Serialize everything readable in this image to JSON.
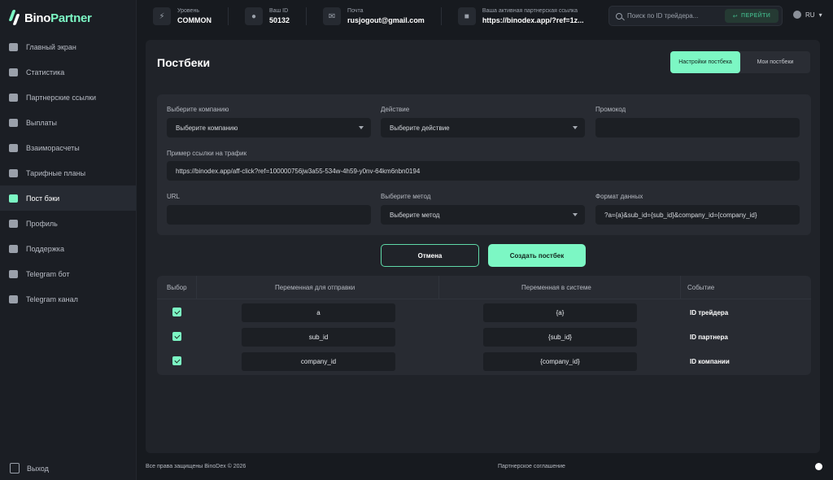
{
  "brand": {
    "name_prefix": "Bino",
    "name_suffix": "Partner"
  },
  "sidebar": {
    "items": [
      {
        "label": "Главный экран",
        "icon": "home-icon"
      },
      {
        "label": "Статистика",
        "icon": "stats-icon"
      },
      {
        "label": "Партнерские ссылки",
        "icon": "link-icon"
      },
      {
        "label": "Выплаты",
        "icon": "payout-icon"
      },
      {
        "label": "Взаиморасчеты",
        "icon": "settlement-icon"
      },
      {
        "label": "Тарифные планы",
        "icon": "tariff-icon"
      },
      {
        "label": "Пост бэки",
        "icon": "postback-icon",
        "active": true
      },
      {
        "label": "Профиль",
        "icon": "profile-icon"
      },
      {
        "label": "Поддержка",
        "icon": "support-icon"
      },
      {
        "label": "Telegram бот",
        "icon": "telegram-icon"
      },
      {
        "label": "Telegram канал",
        "icon": "telegram-icon"
      }
    ],
    "logout": "Выход"
  },
  "topbar": {
    "level_label": "Уровень",
    "level_value": "COMMON",
    "id_label": "Ваш ID",
    "id_value": "50132",
    "email_label": "Почта",
    "email_value": "rusjogout@gmail.com",
    "link_label": "Ваша активная партнерская ссылка",
    "link_value": "https://binodex.app/?ref=1z...",
    "search_placeholder": "Поиск по ID трейдера...",
    "go_label": "ПЕРЕЙТИ",
    "lang": "RU"
  },
  "page": {
    "title": "Постбеки",
    "tabs": [
      "Настройки постбека",
      "Мои постбеки"
    ]
  },
  "form": {
    "company_label": "Выберите компанию",
    "company_value": "Выберите компанию",
    "action_label": "Действие",
    "action_value": "Выберите действие",
    "promo_label": "Промокод",
    "promo_value": "",
    "example_label": "Пример ссылки на трафик",
    "example_value": "https://binodex.app/aff-click?ref=100000756jw3a55-534w-4h59-y0nv-64km6nbn0194",
    "url_label": "URL",
    "url_value": "",
    "method_label": "Выберите метод",
    "method_value": "Выберите метод",
    "format_label": "Формат данных",
    "format_value": "?a={a}&sub_id={sub_id}&company_id={company_id}"
  },
  "actions": {
    "cancel": "Отмена",
    "create": "Создать постбек"
  },
  "table": {
    "headers": [
      "Выбор",
      "Переменная для отправки",
      "Переменная в системе",
      "Событие"
    ],
    "rows": [
      {
        "send": "a",
        "system": "{a}",
        "event": "ID трейдера",
        "checked": true
      },
      {
        "send": "sub_id",
        "system": "{sub_id}",
        "event": "ID партнера",
        "checked": true
      },
      {
        "send": "company_id",
        "system": "{company_id}",
        "event": "ID компании",
        "checked": true
      }
    ]
  },
  "footer": {
    "copyright": "Все права защищены BinoDex © 2026",
    "agreement": "Партнерское соглашение"
  },
  "colors": {
    "accent": "#7cf7c4",
    "background": "#171a1f",
    "panel": "#202329"
  }
}
